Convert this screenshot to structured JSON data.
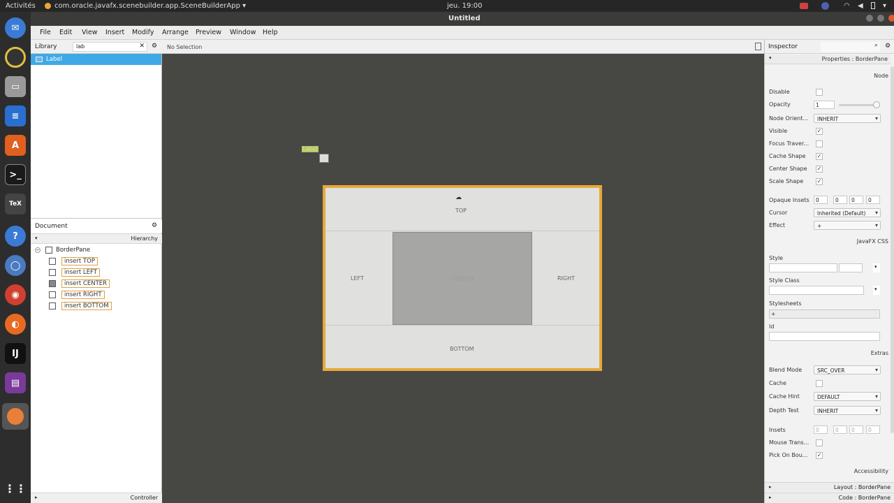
{
  "topbar": {
    "activities": "Activités",
    "app_name": "com.oracle.javafx.scenebuilder.app.SceneBuilderApp ▾",
    "clock": "jeu. 19:00"
  },
  "window": {
    "title": "Untitled"
  },
  "menu": [
    "File",
    "Edit",
    "View",
    "Insert",
    "Modify",
    "Arrange",
    "Preview",
    "Window",
    "Help"
  ],
  "library": {
    "title": "Library",
    "search_value": "lab",
    "items": [
      "Label"
    ]
  },
  "document": {
    "title": "Document",
    "hierarchy_label": "Hierarchy",
    "root": "BorderPane",
    "children": [
      "insert TOP",
      "insert LEFT",
      "insert CENTER",
      "insert RIGHT",
      "insert BOTTOM"
    ],
    "controller_label": "Controller"
  },
  "canvas": {
    "selection": "No Selection",
    "dragged_label": "Label",
    "regions": {
      "top": "TOP",
      "left": "LEFT",
      "center": "CENTER",
      "right": "RIGHT",
      "bottom": "BOTTOM"
    },
    "accent_color": "#e8a838"
  },
  "inspector": {
    "title": "Inspector",
    "properties_header": "Properties : BorderPane",
    "node_section": "Node",
    "fields": {
      "disable": "Disable",
      "opacity": "Opacity",
      "opacity_value": "1",
      "node_orientation": "Node Orient...",
      "node_orientation_value": "INHERIT",
      "visible": "Visible",
      "focus_traversable": "Focus Traver...",
      "cache_shape": "Cache Shape",
      "center_shape": "Center Shape",
      "scale_shape": "Scale Shape",
      "opaque_insets": "Opaque Insets",
      "opaque_insets_values": [
        "0",
        "0",
        "0",
        "0"
      ],
      "cursor": "Cursor",
      "cursor_value": "Inherited (Default)",
      "effect": "Effect",
      "effect_value": "+"
    },
    "javafx_css_section": "JavaFX CSS",
    "css": {
      "style": "Style",
      "style_class": "Style Class",
      "stylesheets": "Stylesheets",
      "stylesheets_add": "+",
      "id": "Id"
    },
    "extras_section": "Extras",
    "extras": {
      "blend_mode": "Blend Mode",
      "blend_mode_value": "SRC_OVER",
      "cache": "Cache",
      "cache_hint": "Cache Hint",
      "cache_hint_value": "DEFAULT",
      "depth_test": "Depth Test",
      "depth_test_value": "INHERIT",
      "insets": "Insets",
      "insets_values": [
        "0",
        "0",
        "0",
        "0"
      ],
      "mouse_transparent": "Mouse Trans...",
      "pick_on_bounds": "Pick On Bou..."
    },
    "accessibility_section": "Accessibility",
    "layout_header": "Layout : BorderPane",
    "code_header": "Code : BorderPane"
  }
}
